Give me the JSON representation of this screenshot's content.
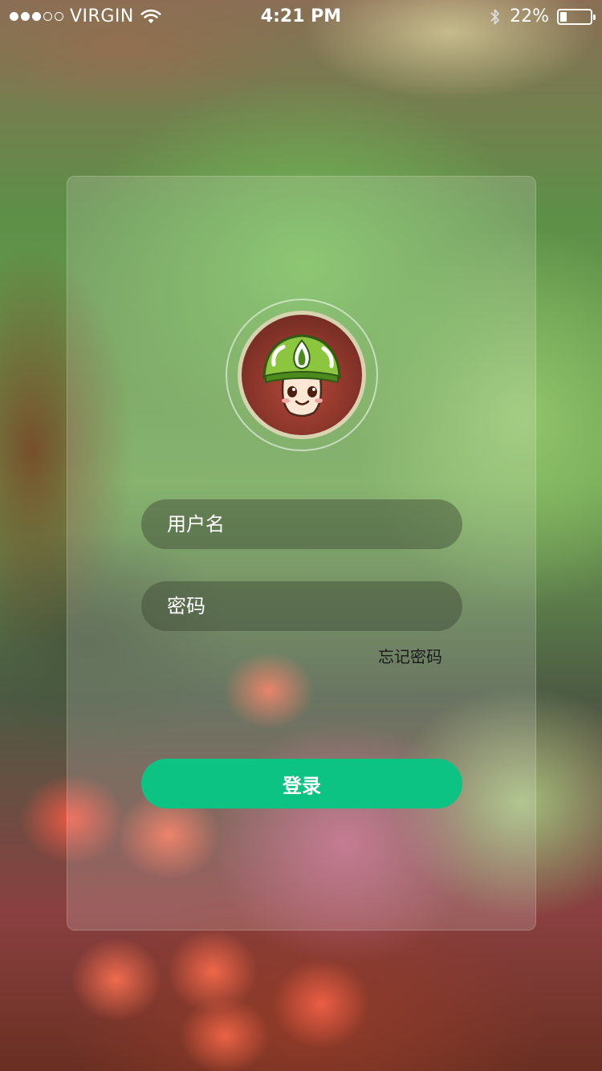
{
  "status_bar": {
    "signal_dots_filled": 3,
    "signal_dots_total": 5,
    "carrier": "VIRGIN",
    "time": "4:21 PM",
    "battery_text": "22%",
    "battery_level": 0.22
  },
  "login": {
    "username_placeholder": "用户名",
    "password_placeholder": "密码",
    "forgot_password": "忘记密码",
    "login_button": "登录"
  },
  "colors": {
    "accent": "#0dc383"
  }
}
